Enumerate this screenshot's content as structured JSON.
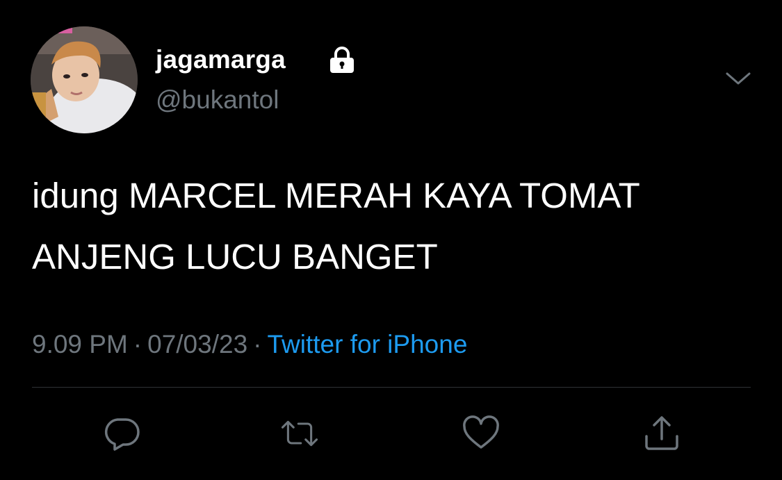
{
  "tweet": {
    "display_name": "jagamarga",
    "handle": "@bukantol",
    "protected": true,
    "text_lines": [
      "idung MARCEL MERAH KAYA TOMAT",
      "ANJENG LUCU BANGET"
    ],
    "time": "9.09 PM",
    "date": "07/03/23",
    "separator": "·",
    "source": "Twitter for iPhone"
  },
  "icons": {
    "lock": "lock-icon",
    "more": "chevron-down-icon",
    "reply": "reply-icon",
    "retweet": "retweet-icon",
    "like": "heart-icon",
    "share": "share-icon"
  },
  "colors": {
    "background": "#000000",
    "text_primary": "#ffffff",
    "text_secondary": "#6e767d",
    "accent": "#1d9bf0",
    "divider": "#2f3336"
  }
}
